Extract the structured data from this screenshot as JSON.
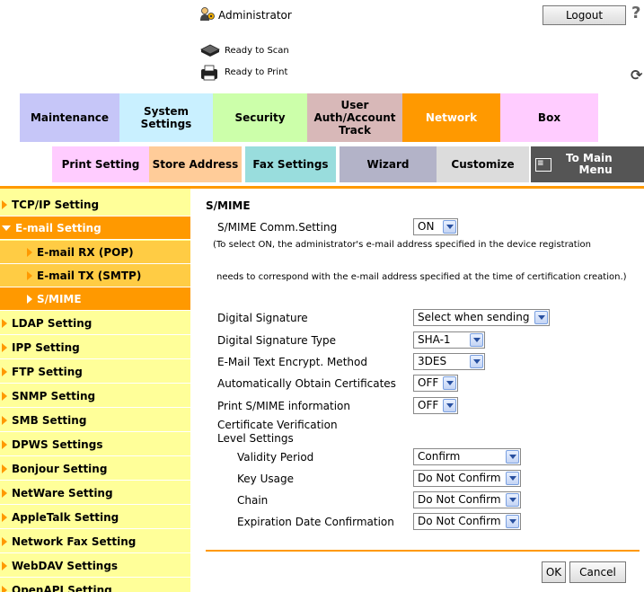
{
  "header": {
    "user": "Administrator",
    "logout_label": "Logout",
    "help_label": "?",
    "scan_status": "Ready to Scan",
    "print_status": "Ready to Print"
  },
  "main_tabs": [
    {
      "label": "Maintenance"
    },
    {
      "label": "System\nSettings"
    },
    {
      "label": "Security"
    },
    {
      "label": "User\nAuth/Account\nTrack"
    },
    {
      "label": "Network",
      "selected": true
    },
    {
      "label": "Box"
    }
  ],
  "sub_tabs": [
    {
      "label": "Print Setting"
    },
    {
      "label": "Store Address"
    },
    {
      "label": "Fax Settings"
    },
    {
      "label": "Wizard"
    },
    {
      "label": "Customize"
    },
    {
      "label": "To Main\nMenu"
    }
  ],
  "sidebar": {
    "items": [
      {
        "label": "TCP/IP Setting"
      },
      {
        "label": "E-mail Setting",
        "open": true
      },
      {
        "label": "E-mail RX (POP)",
        "sub": true
      },
      {
        "label": "E-mail TX (SMTP)",
        "sub": true
      },
      {
        "label": "S/MIME",
        "sub": true,
        "active": true
      },
      {
        "label": "LDAP Setting"
      },
      {
        "label": "IPP Setting"
      },
      {
        "label": "FTP Setting"
      },
      {
        "label": "SNMP Setting"
      },
      {
        "label": "SMB Setting"
      },
      {
        "label": "DPWS Settings"
      },
      {
        "label": "Bonjour Setting"
      },
      {
        "label": "NetWare Setting"
      },
      {
        "label": "AppleTalk Setting"
      },
      {
        "label": "Network Fax Setting"
      },
      {
        "label": "WebDAV Settings"
      },
      {
        "label": "OpenAPI Setting"
      }
    ]
  },
  "form": {
    "title": "S/MIME",
    "comm_label": "S/MIME Comm.Setting",
    "comm_value": "ON",
    "note1": "(To select ON, the administrator's e-mail address specified in the device registration",
    "note2": "needs to correspond with the e-mail address specified at the time of certification creation.)",
    "sig_label": "Digital Signature",
    "sig_value": "Select when sending",
    "sigtype_label": "Digital Signature Type",
    "sigtype_value": "SHA-1",
    "enc_label": "E-Mail Text Encrypt. Method",
    "enc_value": "3DES",
    "auto_label": "Automatically Obtain Certificates",
    "auto_value": "OFF",
    "info_label": "Print S/MIME information",
    "info_value": "OFF",
    "cert_label": "Certificate Verification Level Settings",
    "validity_label": "Validity Period",
    "validity_value": "Confirm",
    "keyusage_label": "Key Usage",
    "keyusage_value": "Do Not Confirm",
    "chain_label": "Chain",
    "chain_value": "Do Not Confirm",
    "expiry_label": "Expiration Date Confirmation",
    "expiry_value": "Do Not Confirm",
    "ok_label": "OK",
    "cancel_label": "Cancel"
  },
  "colors": {
    "accent": "#ff9900",
    "sidebar_bg": "#ffff99",
    "sidebar_sub_bg": "#ffcc44"
  }
}
